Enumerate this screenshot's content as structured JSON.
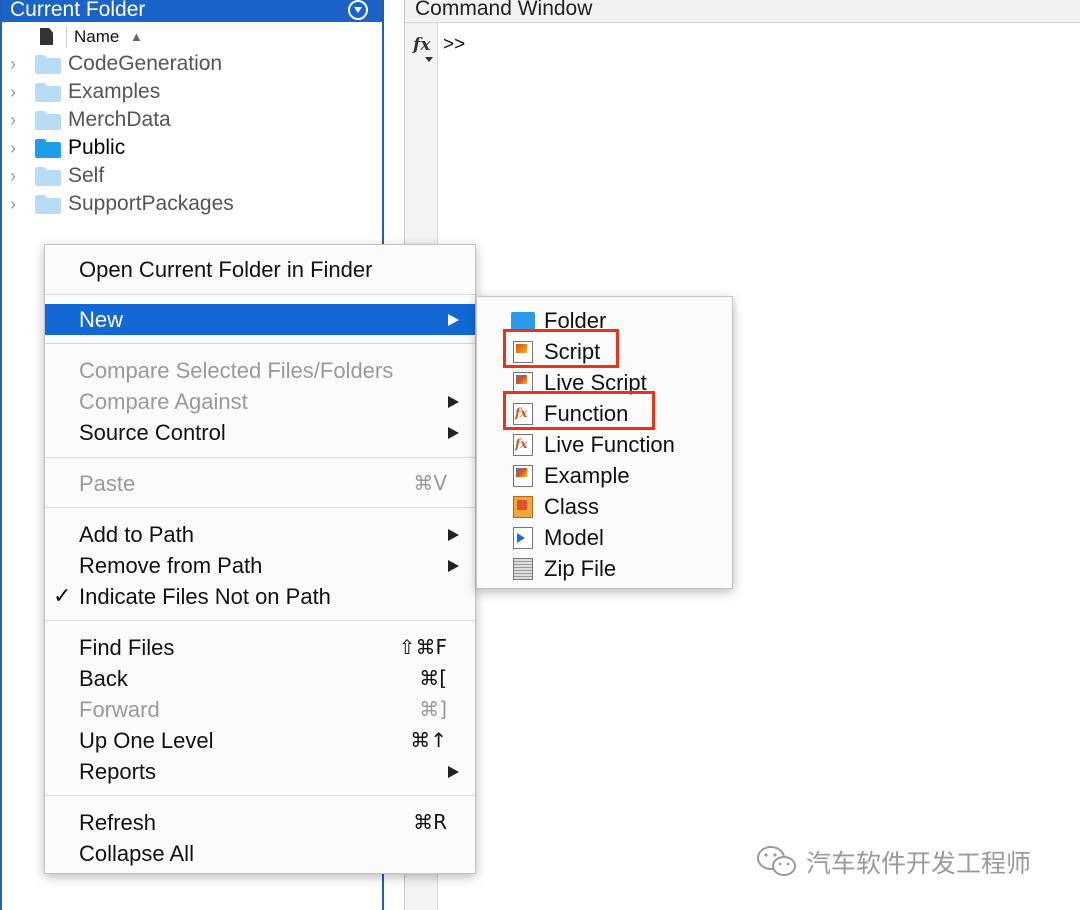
{
  "current_folder": {
    "title": "Current Folder",
    "column_header": "Name",
    "sort_indicator": "▲",
    "items": [
      {
        "label": "CodeGeneration",
        "color": "#b9dcf6",
        "dim": true
      },
      {
        "label": "Examples",
        "color": "#b9dcf6",
        "dim": true
      },
      {
        "label": "MerchData",
        "color": "#b9dcf6",
        "dim": true
      },
      {
        "label": "Public",
        "color": "#1e9de9",
        "dim": false
      },
      {
        "label": "Self",
        "color": "#b9dcf6",
        "dim": true
      },
      {
        "label": "SupportPackages",
        "color": "#b9dcf6",
        "dim": true
      }
    ]
  },
  "command_window": {
    "title": "Command Window",
    "fx_icon": "fx",
    "prompt": ">>"
  },
  "context_menu": {
    "open_in_finder": "Open Current Folder in Finder",
    "new": "New",
    "compare_selected": "Compare Selected Files/Folders",
    "compare_against": "Compare Against",
    "source_control": "Source Control",
    "paste": "Paste",
    "paste_shortcut": "⌘V",
    "add_to_path": "Add to Path",
    "remove_from_path": "Remove from Path",
    "indicate_not_on_path": "Indicate Files Not on Path",
    "check_mark": "✓",
    "find_files": "Find Files",
    "find_files_shortcut": "⇧⌘F",
    "back": "Back",
    "back_shortcut": "⌘[",
    "forward": "Forward",
    "forward_shortcut": "⌘]",
    "up_one_level": "Up One Level",
    "up_one_level_shortcut": "⌘↑",
    "reports": "Reports",
    "refresh": "Refresh",
    "refresh_shortcut": "⌘R",
    "collapse_all": "Collapse All"
  },
  "new_submenu": {
    "folder": "Folder",
    "script": "Script",
    "live_script": "Live Script",
    "function": "Function",
    "live_function": "Live Function",
    "example": "Example",
    "class": "Class",
    "model": "Model",
    "zip_file": "Zip File"
  },
  "colors": {
    "accent": "#1368d5",
    "highlight_box": "#e8341c"
  },
  "watermark": {
    "text": "汽车软件开发工程师"
  }
}
